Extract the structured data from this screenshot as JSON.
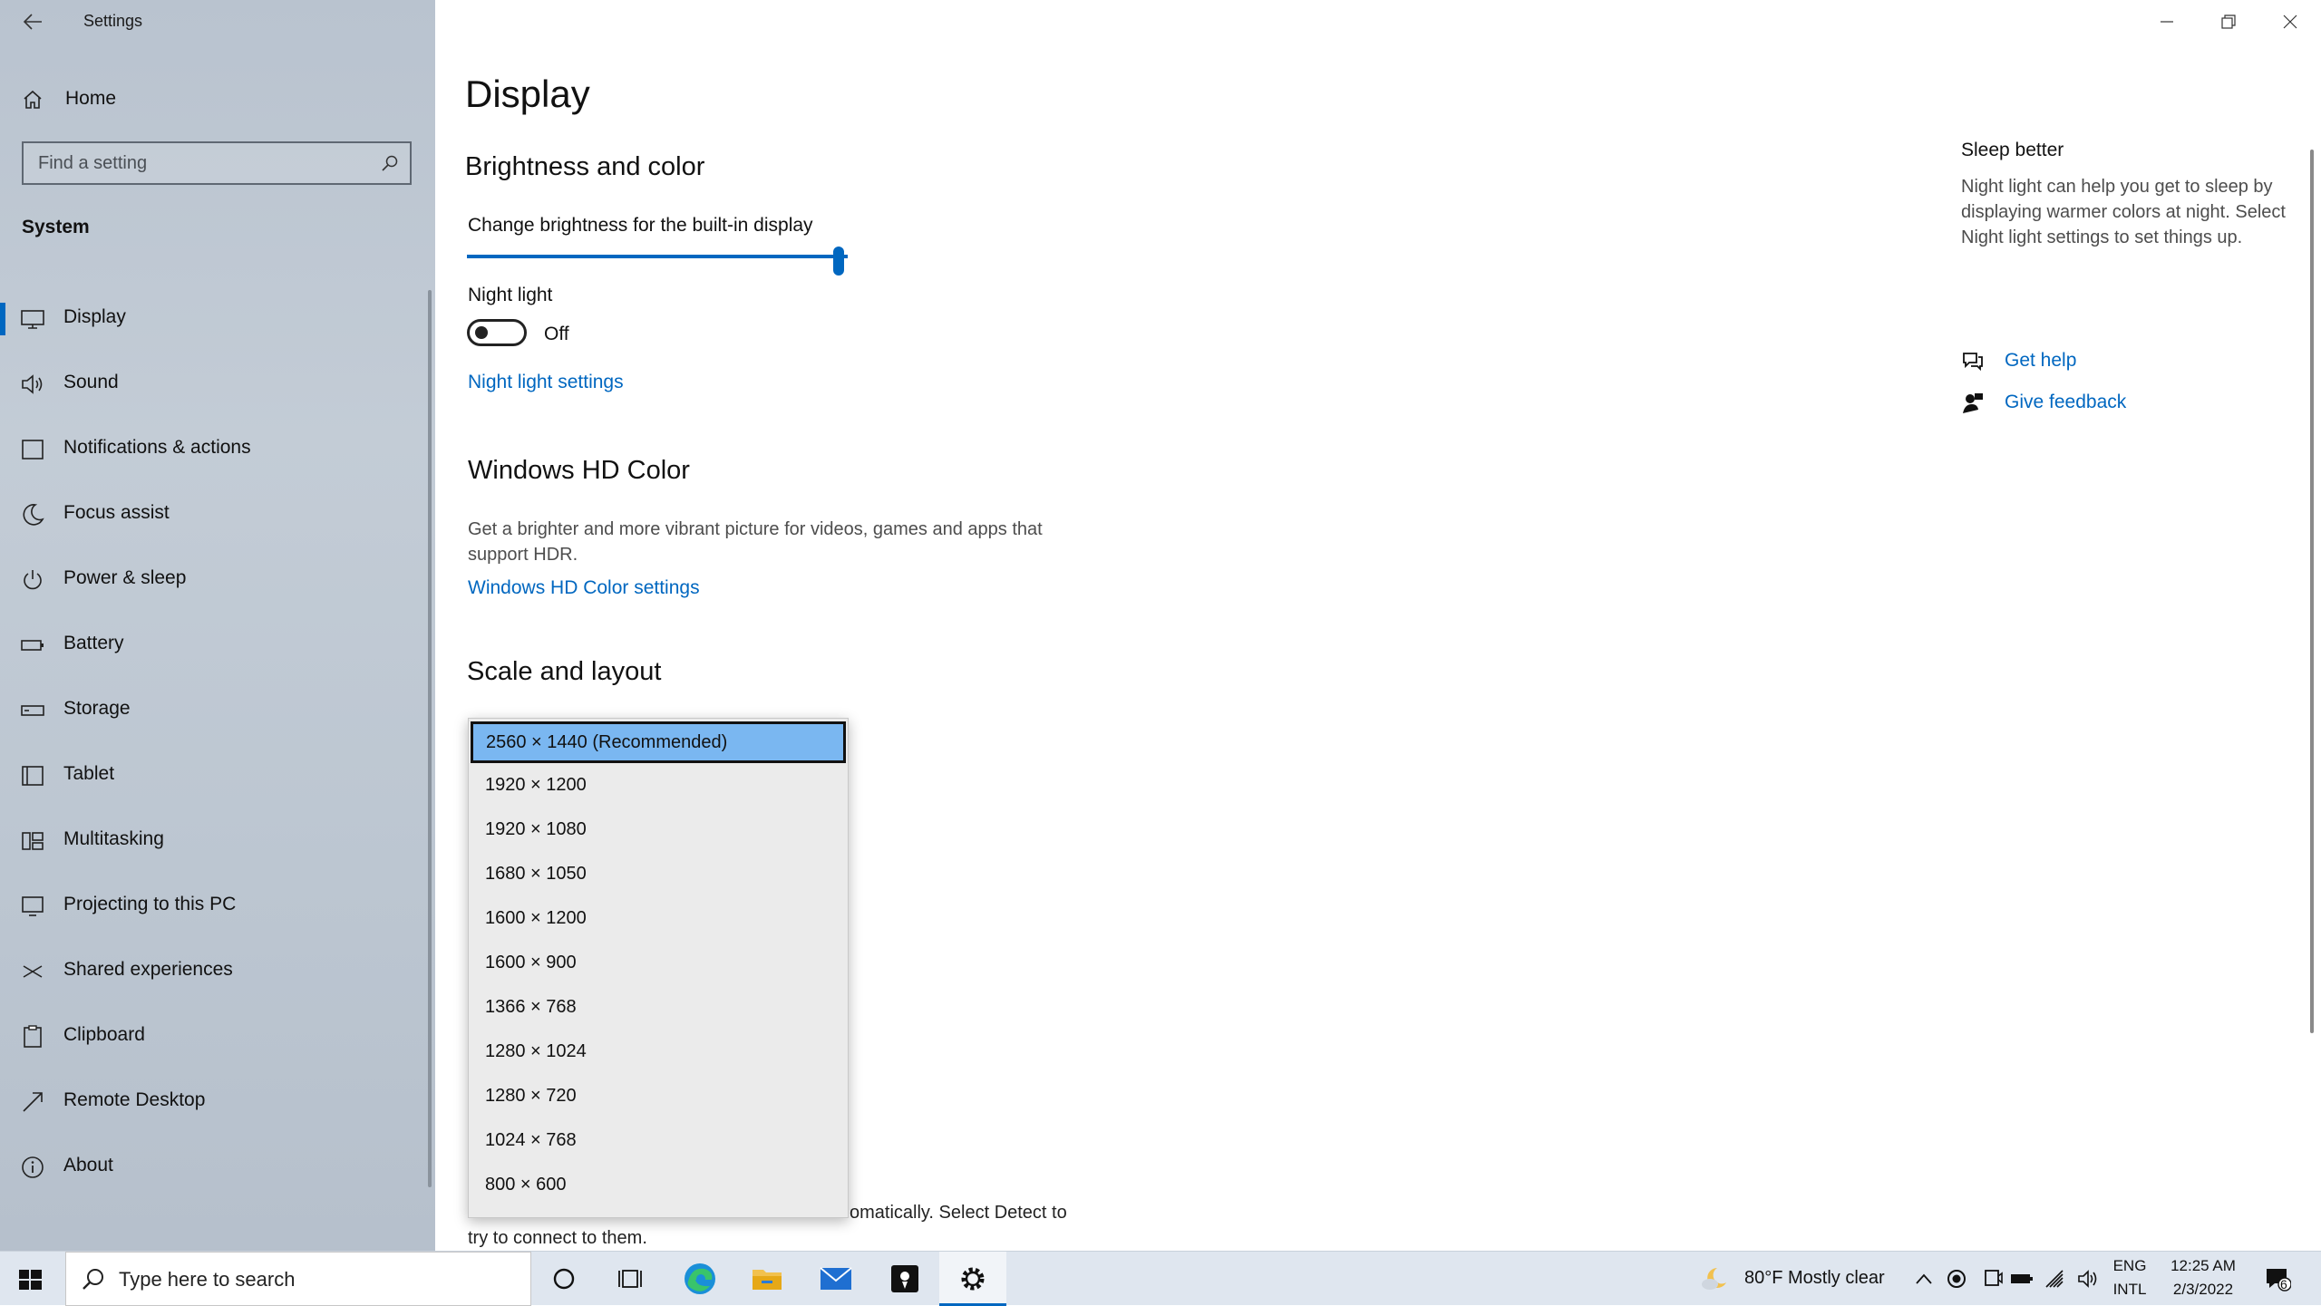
{
  "window": {
    "app_title": "Settings",
    "controls": [
      "minimize-icon",
      "restore-icon",
      "close-icon"
    ]
  },
  "sidebar": {
    "home_label": "Home",
    "search_placeholder": "Find a setting",
    "section_title": "System",
    "items": [
      {
        "label": "Display",
        "icon": "monitor-icon",
        "selected": true
      },
      {
        "label": "Sound",
        "icon": "speaker-icon"
      },
      {
        "label": "Notifications & actions",
        "icon": "notification-icon"
      },
      {
        "label": "Focus assist",
        "icon": "moon-icon"
      },
      {
        "label": "Power & sleep",
        "icon": "power-icon"
      },
      {
        "label": "Battery",
        "icon": "battery-icon"
      },
      {
        "label": "Storage",
        "icon": "storage-icon"
      },
      {
        "label": "Tablet",
        "icon": "tablet-icon"
      },
      {
        "label": "Multitasking",
        "icon": "multitasking-icon"
      },
      {
        "label": "Projecting to this PC",
        "icon": "projecting-icon"
      },
      {
        "label": "Shared experiences",
        "icon": "share-icon"
      },
      {
        "label": "Clipboard",
        "icon": "clipboard-icon"
      },
      {
        "label": "Remote Desktop",
        "icon": "remote-desktop-icon"
      },
      {
        "label": "About",
        "icon": "info-icon"
      }
    ]
  },
  "main": {
    "page_title": "Display",
    "brightness": {
      "heading": "Brightness and color",
      "slider_label": "Change brightness for the built-in display",
      "value_percent": 100
    },
    "night_light": {
      "label": "Night light",
      "state": "Off",
      "settings_link": "Night light settings"
    },
    "hd_color": {
      "heading": "Windows HD Color",
      "description_line1": "Get a brighter and more vibrant picture for videos, games and apps that",
      "description_line2": "support HDR.",
      "settings_link": "Windows HD Color settings"
    },
    "scale_layout": {
      "heading": "Scale and layout",
      "resolution_options": [
        "2560 × 1440 (Recommended)",
        "1920 × 1200",
        "1920 × 1080",
        "1680 × 1050",
        "1600 × 1200",
        "1600 × 900",
        "1366 × 768",
        "1280 × 1024",
        "1280 × 720",
        "1024 × 768",
        "800 × 600"
      ],
      "selected_index": 0
    },
    "detect_text_fragment": "omatically. Select Detect to",
    "detect_text_line2": "try to connect to them."
  },
  "aside": {
    "title": "Sleep better",
    "description": "Night light can help you get to sleep by displaying warmer colors at night. Select Night light settings to set things up.",
    "get_help": "Get help",
    "give_feedback": "Give feedback"
  },
  "taskbar": {
    "search_placeholder": "Type here to search",
    "weather": "80°F  Mostly clear",
    "lang_top": "ENG",
    "lang_bottom": "INTL",
    "time": "12:25 AM",
    "date": "2/3/2022",
    "notification_count": "6"
  },
  "colors": {
    "accent": "#0067c0",
    "selected_option": "#7ab7f1"
  }
}
